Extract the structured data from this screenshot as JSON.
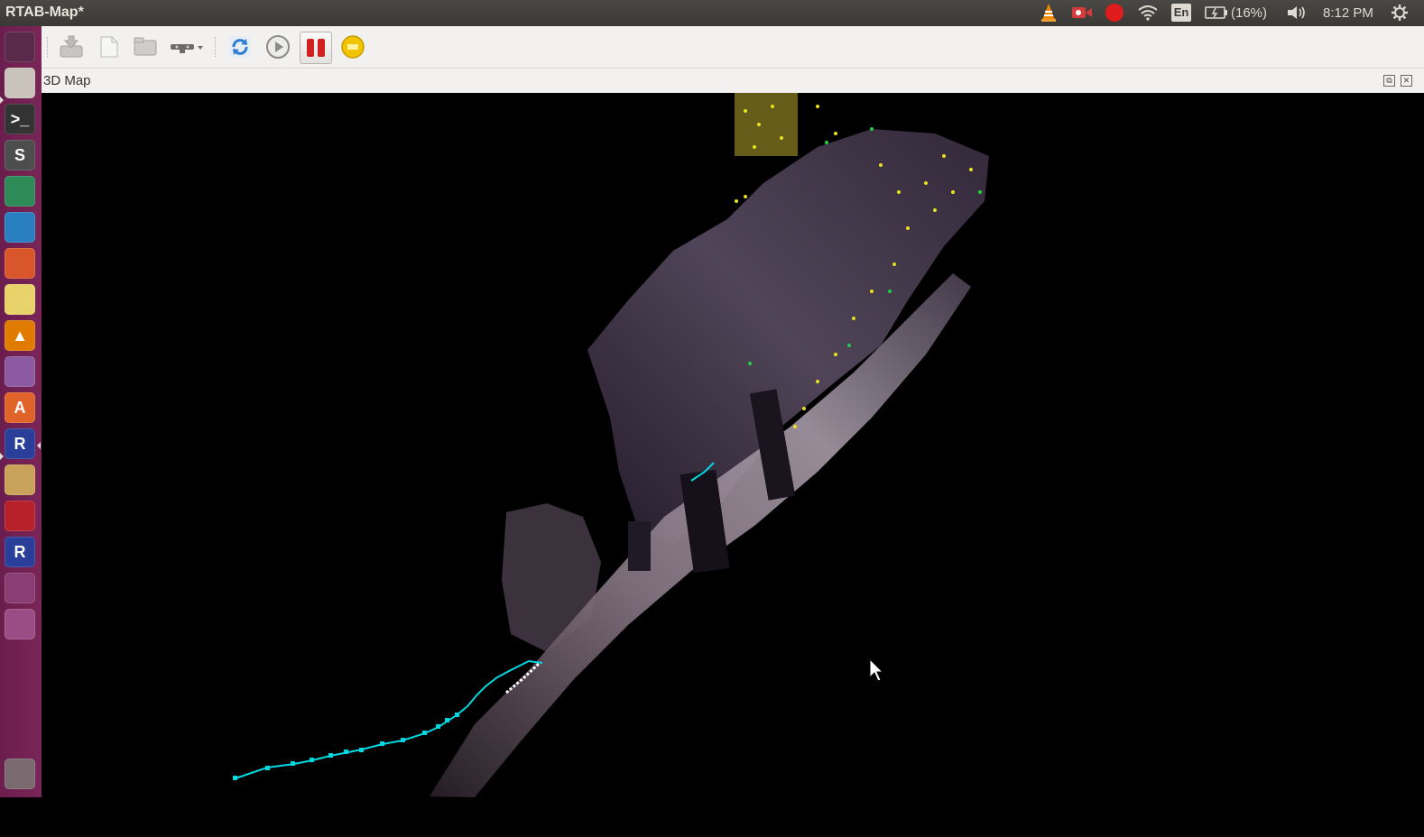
{
  "top_panel": {
    "window_title": "RTAB-Map*",
    "indicators": [
      {
        "name": "vlc-icon",
        "color": "#f08a00"
      },
      {
        "name": "screen-recorder-icon",
        "color": "#d63a3a"
      },
      {
        "name": "record-indicator-icon",
        "color": "#e01b1b"
      },
      {
        "name": "wifi-icon",
        "color": "#dfdbd2"
      }
    ],
    "language": "En",
    "battery": "(16%)",
    "clock": "8:12 PM"
  },
  "launcher": {
    "items": [
      {
        "name": "dash-home-icon",
        "glyph": "",
        "color": "#5a2a4a"
      },
      {
        "name": "files-icon",
        "glyph": "",
        "color": "#c9c3bb"
      },
      {
        "name": "terminal-icon",
        "glyph": ">_",
        "color": "#333333"
      },
      {
        "name": "sublime-text-icon",
        "glyph": "S",
        "color": "#4d4d4d"
      },
      {
        "name": "chrome-icon",
        "glyph": "",
        "color": "#2e8b57"
      },
      {
        "name": "libreoffice-writer-icon",
        "glyph": "",
        "color": "#2a7fc1"
      },
      {
        "name": "libreoffice-impress-icon",
        "glyph": "",
        "color": "#d9562b"
      },
      {
        "name": "sticky-notes-icon",
        "glyph": "",
        "color": "#e8d36a"
      },
      {
        "name": "vlc-launcher-icon",
        "glyph": "▲",
        "color": "#e07b00"
      },
      {
        "name": "window-app-icon",
        "glyph": "",
        "color": "#8b5aa0"
      },
      {
        "name": "software-center-icon",
        "glyph": "A",
        "color": "#e0632a"
      },
      {
        "name": "rtabmap-launcher-icon",
        "glyph": "R",
        "color": "#2a3f9a"
      },
      {
        "name": "scanner-icon",
        "glyph": "",
        "color": "#c9a35a"
      },
      {
        "name": "screen-recorder-launcher-icon",
        "glyph": "",
        "color": "#b8202a"
      },
      {
        "name": "rtabmap-second-icon",
        "glyph": "R",
        "color": "#2a3f9a"
      },
      {
        "name": "workspace-switcher-icon",
        "glyph": "",
        "color": "#8a3d72"
      },
      {
        "name": "usb-drive-icon",
        "glyph": "",
        "color": "#9a4d84"
      },
      {
        "name": "trash-icon",
        "glyph": "",
        "color": "#7a6a70"
      }
    ]
  },
  "toolbar": {
    "buttons": [
      {
        "name": "save-button"
      },
      {
        "name": "new-database-button"
      },
      {
        "name": "open-database-button"
      },
      {
        "name": "source-selector-button"
      },
      {
        "name": "refresh-button"
      },
      {
        "name": "play-button"
      },
      {
        "name": "pause-button"
      },
      {
        "name": "stop-button"
      }
    ]
  },
  "dock": {
    "title": "3D Map",
    "float_symbol": "⧉",
    "close_symbol": "✕"
  },
  "viewport": {
    "trajectory_color": "#00d8e0",
    "cloud_base_color": "#6a5a72",
    "feature_color_yellow": "#e8e020",
    "feature_color_green": "#20d040"
  }
}
